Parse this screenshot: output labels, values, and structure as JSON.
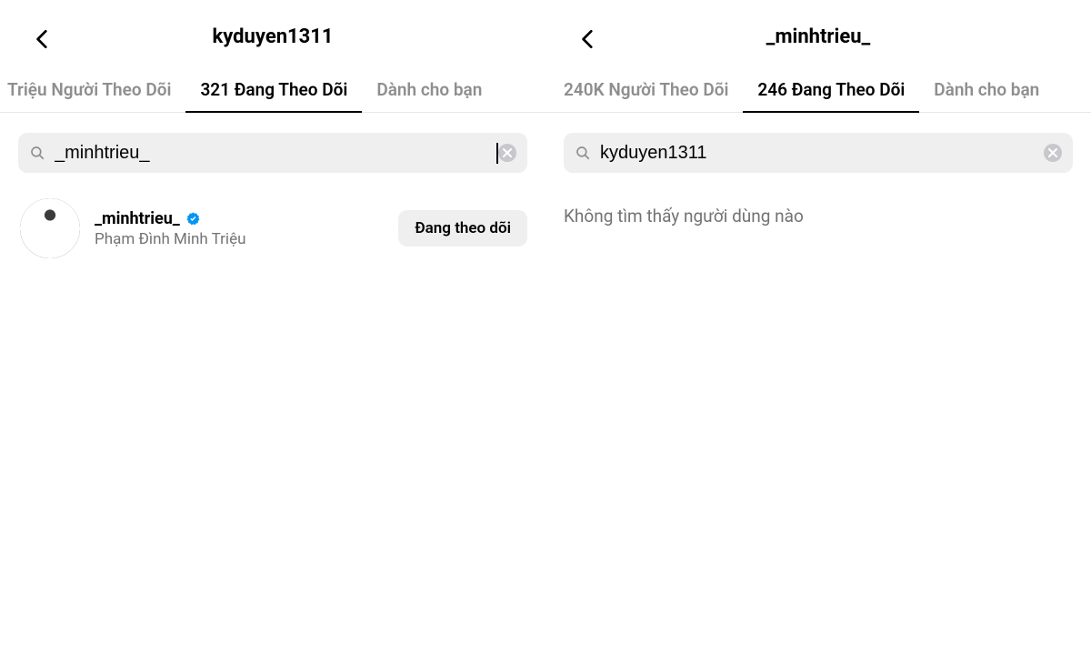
{
  "left": {
    "header_title": "kyduyen1311",
    "tabs": [
      {
        "label": "Triệu Người Theo Dõi",
        "active": false
      },
      {
        "label": "321 Đang Theo Dõi",
        "active": true
      },
      {
        "label": "Dành cho bạn",
        "active": false
      }
    ],
    "search_value": "_minhtrieu_",
    "result": {
      "username": "_minhtrieu_",
      "fullname": "Phạm Đình Minh Triệu",
      "follow_label": "Đang theo dõi"
    }
  },
  "right": {
    "header_title": "_minhtrieu_",
    "tabs": [
      {
        "label": "240K Người Theo Dõi",
        "active": false
      },
      {
        "label": "246 Đang Theo Dõi",
        "active": true
      },
      {
        "label": "Dành cho bạn",
        "active": false
      }
    ],
    "search_value": "kyduyen1311",
    "empty_message": "Không tìm thấy người dùng nào"
  }
}
